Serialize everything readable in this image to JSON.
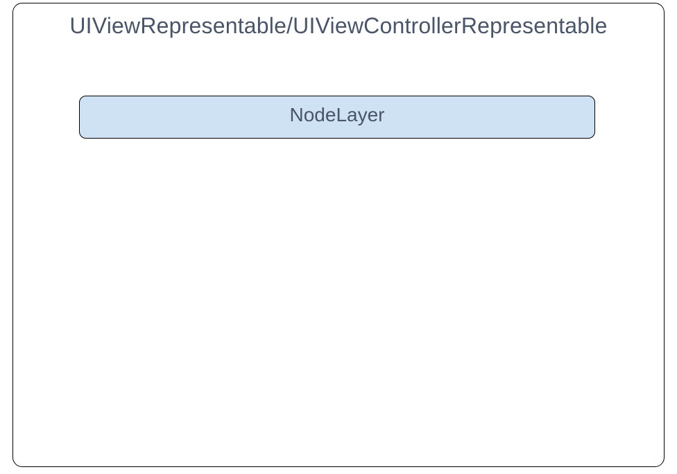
{
  "diagram": {
    "outer": {
      "title": "UIViewRepresentable/UIViewControllerRepresentable",
      "border_color": "#000000",
      "background_color": "#ffffff"
    },
    "inner": {
      "label": "NodeLayer",
      "background_color": "#cfe2f3",
      "border_color": "#000000"
    },
    "text_color": "#4a5568"
  }
}
